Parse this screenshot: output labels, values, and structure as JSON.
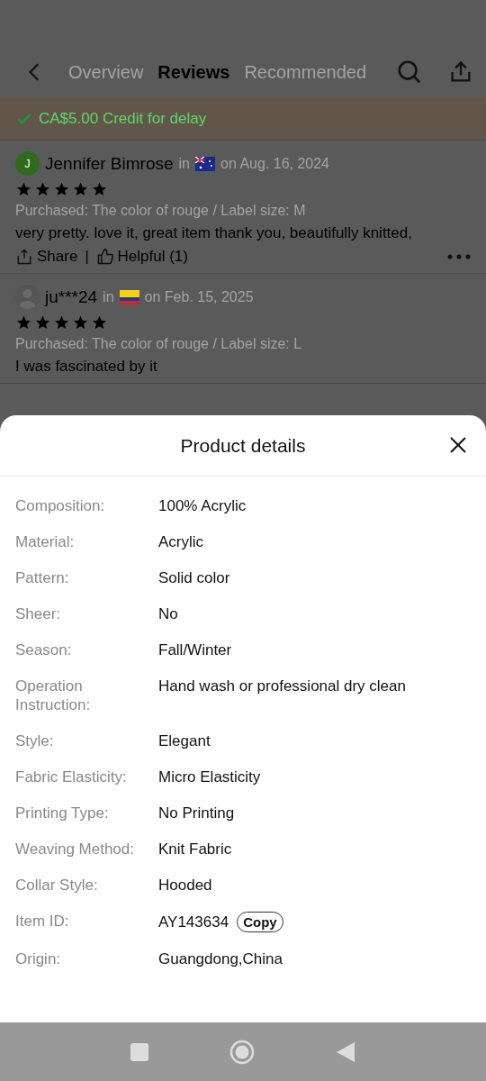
{
  "nav": {
    "tabs": [
      {
        "label": "Overview",
        "selected": false
      },
      {
        "label": "Reviews",
        "selected": true
      },
      {
        "label": "Recommended",
        "selected": false
      }
    ]
  },
  "banner": {
    "text": "CA$5.00 Credit for delay"
  },
  "reviews": [
    {
      "avatar": {
        "kind": "letter",
        "letter": "J"
      },
      "name": "Jennifer Bimrose",
      "in": "in",
      "flag": {
        "kind": "au"
      },
      "date": "on Aug. 16, 2024",
      "stars": 5,
      "purchased": "Purchased: The color of rouge / Label size: M",
      "text": "very pretty. love it, great item thank you, beautifully knitted,",
      "actions": {
        "share": "Share",
        "separator": "|",
        "helpful": "Helpful (1)"
      }
    },
    {
      "avatar": {
        "kind": "silhouette"
      },
      "name": "ju***24",
      "in": "in",
      "flag": {
        "kind": "co"
      },
      "date": "on Feb. 15, 2025",
      "stars": 5,
      "purchased": "Purchased: The color of rouge / Label size: L",
      "text": "I was fascinated by it"
    }
  ],
  "sheet": {
    "title": "Product details",
    "rows": [
      {
        "label": "Composition:",
        "value": "100% Acrylic"
      },
      {
        "label": "Material:",
        "value": "Acrylic"
      },
      {
        "label": "Pattern:",
        "value": "Solid color"
      },
      {
        "label": "Sheer:",
        "value": "No"
      },
      {
        "label": "Season:",
        "value": "Fall/Winter"
      },
      {
        "label": "Operation Instruction:",
        "value": "Hand wash or professional dry clean"
      },
      {
        "label": "Style:",
        "value": "Elegant"
      },
      {
        "label": "Fabric Elasticity:",
        "value": "Micro Elasticity"
      },
      {
        "label": "Printing Type:",
        "value": "No Printing"
      },
      {
        "label": "Weaving Method:",
        "value": "Knit Fabric"
      },
      {
        "label": "Collar Style:",
        "value": "Hooded"
      },
      {
        "label": "Item ID:",
        "value": "AY143634",
        "action": "Copy"
      },
      {
        "label": "Origin:",
        "value": "Guangdong,China"
      }
    ]
  }
}
